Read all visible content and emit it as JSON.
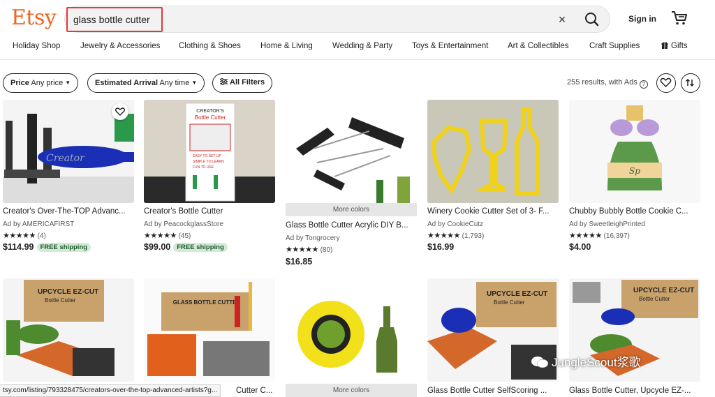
{
  "header": {
    "logo": "Etsy",
    "search_value": "glass bottle cutter",
    "clear_label": "×",
    "signin": "Sign in"
  },
  "categories": [
    "Holiday Shop",
    "Jewelry & Accessories",
    "Clothing & Shoes",
    "Home & Living",
    "Wedding & Party",
    "Toys & Entertainment",
    "Art & Collectibles",
    "Craft Supplies",
    "Gifts"
  ],
  "filters": {
    "price_label": "Price",
    "price_value": "Any price",
    "arrival_label": "Estimated Arrival",
    "arrival_value": "Any time",
    "all_filters": "All Filters"
  },
  "results_text": "255 results, with Ads",
  "help_glyph": "?",
  "listings": [
    {
      "title": "Creator's Over-The-TOP Advanc...",
      "shop": "Ad by AMERICAFIRST",
      "stars": "★★★★★",
      "reviews": "(4)",
      "price": "$114.99",
      "badge": "FREE shipping"
    },
    {
      "title": "Creator's Bottle Cutter",
      "shop": "Ad by PeacockglassStore",
      "stars": "★★★★★",
      "reviews": "(45)",
      "price": "$99.00",
      "badge": "FREE shipping"
    },
    {
      "title": "Glass Bottle Cutter Acrylic DIY B...",
      "shop": "Ad by Tongrocery",
      "stars": "★★★★★",
      "reviews": "(80)",
      "price": "$16.85",
      "badge": "",
      "more": "More colors"
    },
    {
      "title": "Winery Cookie Cutter Set of 3- F...",
      "shop": "Ad by CookieCutz",
      "stars": "★★★★★",
      "reviews": "(1,793)",
      "price": "$16.99",
      "badge": ""
    },
    {
      "title": "Chubby Bubbly Bottle Cookie C...",
      "shop": "Ad by SweetleighPrinted",
      "stars": "★★★★★",
      "reviews": "(16,397)",
      "price": "$4.00",
      "badge": ""
    }
  ],
  "row2": {
    "title_2": "Cutter C...",
    "more_3": "More colors",
    "title_4": "Glass Bottle Cutter SelfScoring ...",
    "title_5": "Glass Bottle Cutter, Upcycle EZ-..."
  },
  "image_text": {
    "creator_word": "Creator",
    "poster_line1": "CREATOR'S",
    "poster_line2": "Bottle Cutter",
    "poster_l1": "EASY TO SET UP",
    "poster_l2": "SIMPLE TO LEARN",
    "poster_l3": "FUN TO USE",
    "cookie_text": "Sp",
    "box_brand": "UPCYCLE EZ-CUT",
    "box_sub": "Bottle Cutter",
    "box2_brand": "GLASS BOTTLE CUTTER"
  },
  "status_url": "tsy.com/listing/793328475/creators-over-the-top-advanced-artists?g...",
  "watermark": "JungleScout浆歌",
  "colors": {
    "brand": "#f1641e",
    "free_bg": "#d4e9d7",
    "highlight": "#e03a3a"
  },
  "icons": [
    "search-icon",
    "close-icon",
    "cart-icon",
    "heart-icon",
    "sort-icon",
    "filter-icon",
    "gift-icon",
    "help-icon"
  ]
}
